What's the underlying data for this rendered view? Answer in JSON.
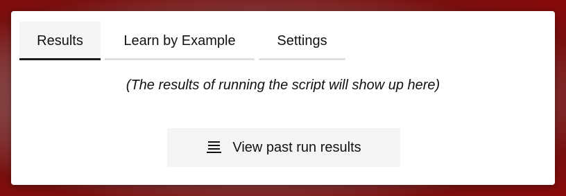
{
  "tabs": [
    {
      "label": "Results",
      "active": true
    },
    {
      "label": "Learn by Example",
      "active": false
    },
    {
      "label": "Settings",
      "active": false
    }
  ],
  "results": {
    "placeholder_text": "(The results of running the script will show up here)"
  },
  "past_runs_button": {
    "icon": "list-icon",
    "label": "View past run results"
  }
}
